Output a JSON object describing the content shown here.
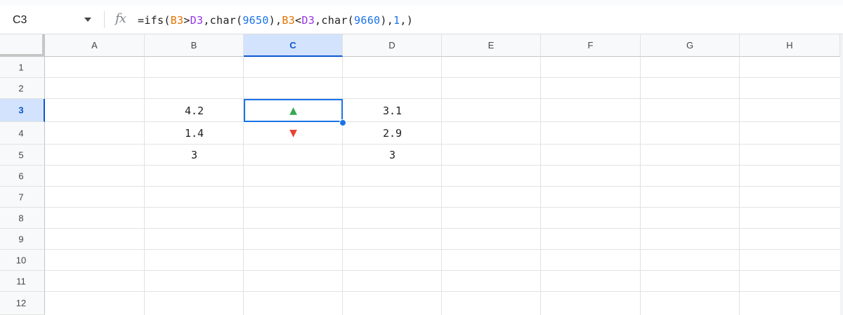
{
  "formula_bar": {
    "name_box": "C3",
    "formula_tokens": [
      {
        "text": "=ifs(",
        "color": "default"
      },
      {
        "text": "B3",
        "color": "orange"
      },
      {
        "text": ">",
        "color": "default"
      },
      {
        "text": "D3",
        "color": "purple"
      },
      {
        "text": ",char(",
        "color": "default"
      },
      {
        "text": "9650",
        "color": "blue"
      },
      {
        "text": "),",
        "color": "default"
      },
      {
        "text": "B3",
        "color": "orange"
      },
      {
        "text": "<",
        "color": "default"
      },
      {
        "text": "D3",
        "color": "purple"
      },
      {
        "text": ",char(",
        "color": "default"
      },
      {
        "text": "9660",
        "color": "blue"
      },
      {
        "text": "),",
        "color": "default"
      },
      {
        "text": "1",
        "color": "blue"
      },
      {
        "text": ",)",
        "color": "default"
      }
    ],
    "fx_icon": "function-fx-icon"
  },
  "grid": {
    "columns": [
      "A",
      "B",
      "C",
      "D",
      "E",
      "F",
      "G",
      "H"
    ],
    "rows": [
      "1",
      "2",
      "3",
      "4",
      "5",
      "6",
      "7",
      "8",
      "9",
      "10",
      "11",
      "12"
    ],
    "selected_cell": "C3",
    "selected_column": "C",
    "selected_row": "3",
    "cells": {
      "B3": "4.2",
      "C3": "▲",
      "D3": "3.1",
      "B4": "1.4",
      "C4": "▼",
      "D4": "2.9",
      "B5": "3",
      "D5": "3"
    }
  },
  "colors": {
    "selection": "#1a73e8",
    "up_arrow": "#34a853",
    "down_arrow": "#ea4335",
    "ref_b3": "#e37400",
    "ref_d3": "#9334e6",
    "number": "#1a73e8"
  }
}
